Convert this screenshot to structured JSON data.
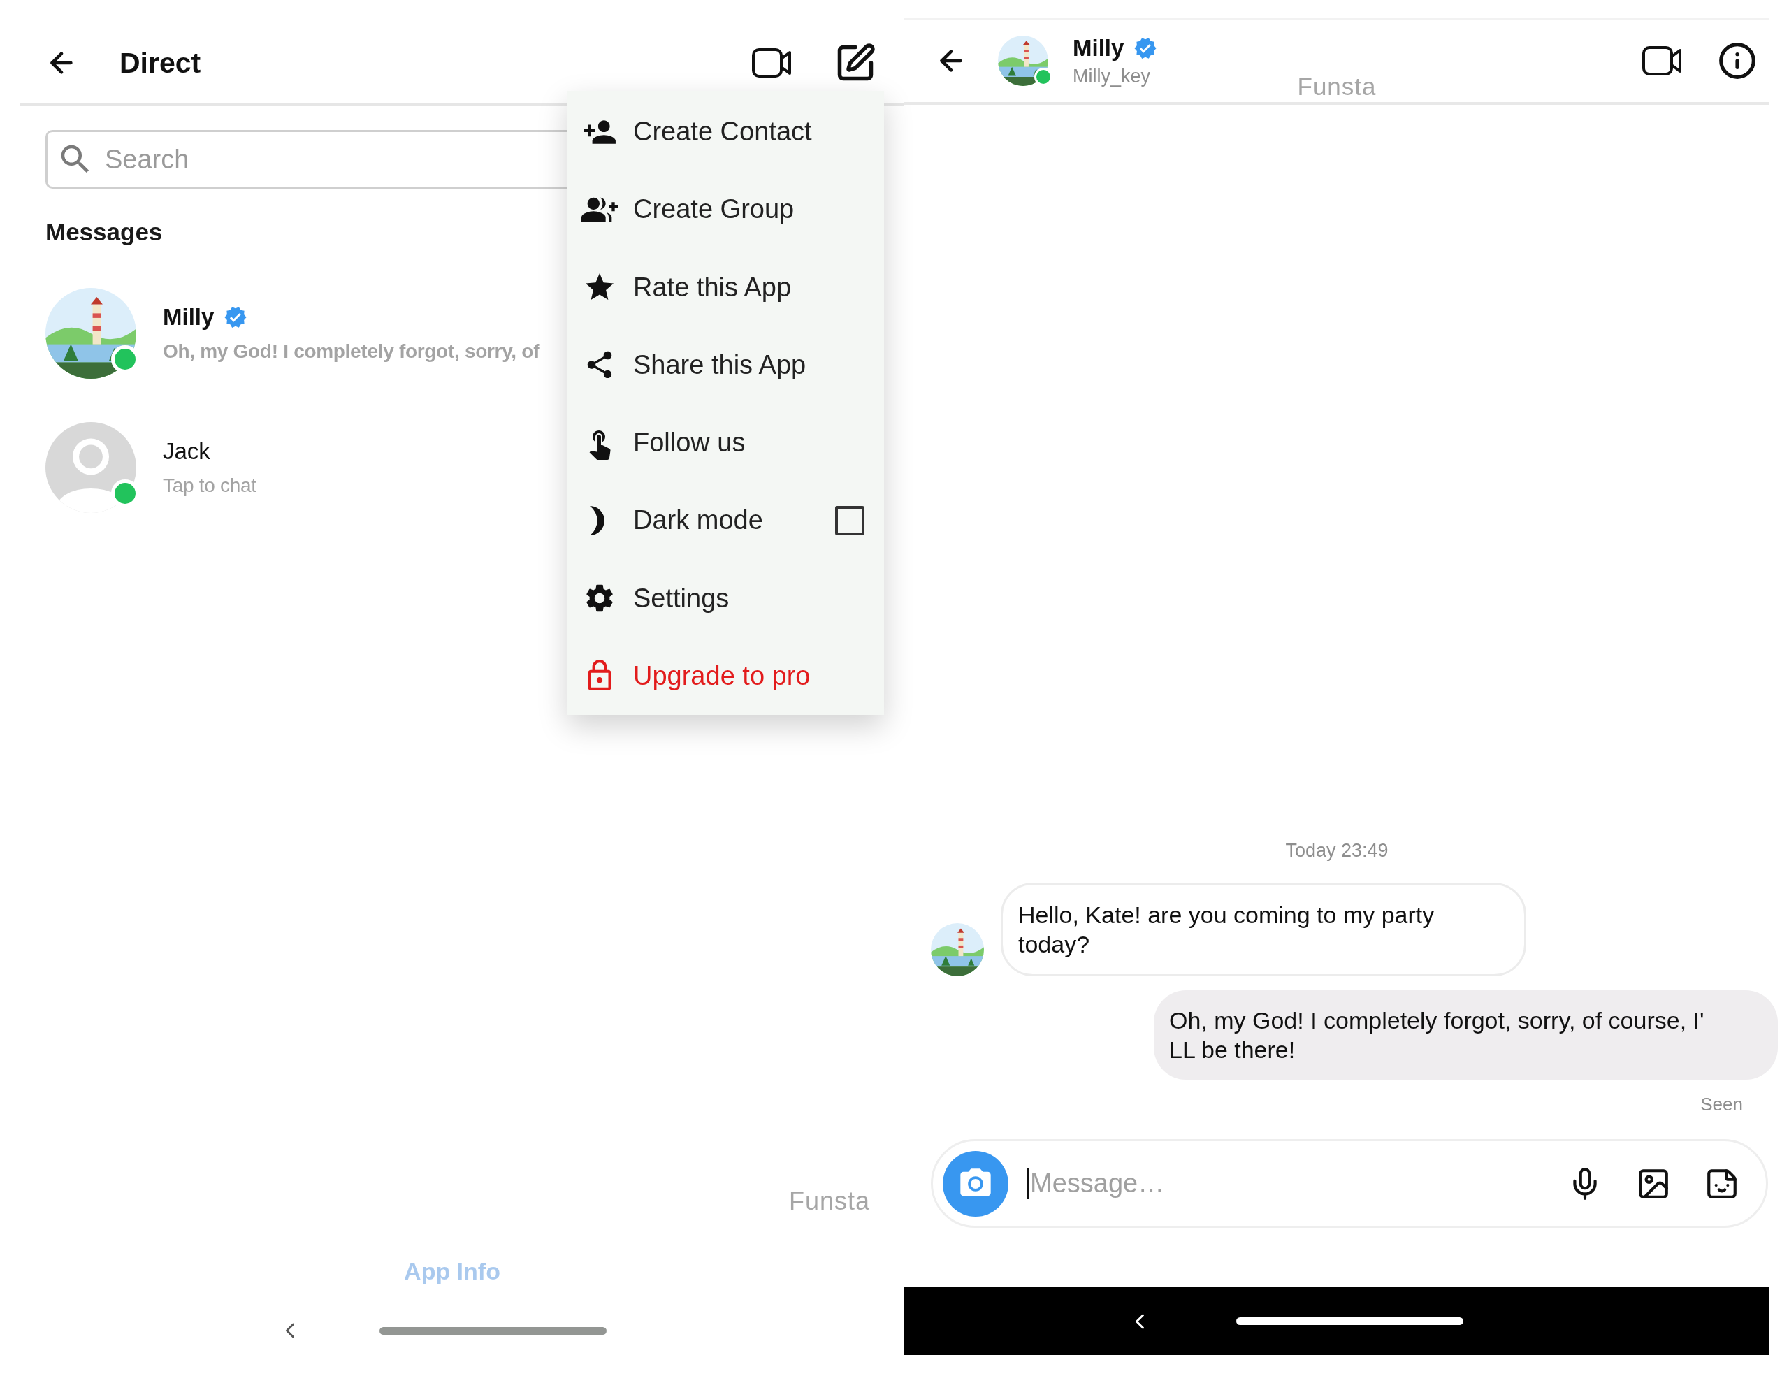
{
  "left_screen": {
    "header": {
      "title": "Direct"
    },
    "search": {
      "placeholder": "Search"
    },
    "section_title": "Messages",
    "conversations": [
      {
        "name": "Milly",
        "verified": true,
        "online": true,
        "photo": true,
        "unread": true,
        "preview": "Oh, my God! I completely forgot, sorry, of"
      },
      {
        "name": "Jack",
        "verified": false,
        "online": true,
        "photo": false,
        "unread": false,
        "preview": "Tap to chat"
      }
    ],
    "menu": [
      {
        "kind": "action",
        "label": "Create Contact"
      },
      {
        "kind": "action",
        "label": "Create Group"
      },
      {
        "kind": "action",
        "label": "Rate this App"
      },
      {
        "kind": "action",
        "label": "Share this App"
      },
      {
        "kind": "action",
        "label": "Follow us"
      },
      {
        "kind": "toggle",
        "label": "Dark mode",
        "checked": false
      },
      {
        "kind": "action",
        "label": "Settings"
      },
      {
        "kind": "upgrade",
        "label": "Upgrade to pro"
      }
    ],
    "brand_label": "Funsta",
    "footer_link": "App Info"
  },
  "right_screen": {
    "header": {
      "name": "Milly",
      "username": "Milly_key",
      "verified": true,
      "online": true
    },
    "brand_label": "Funsta",
    "timestamp": "Today 23:49",
    "messages": [
      {
        "outgoing": false,
        "text": "Hello, Kate! are you coming to my party today?"
      },
      {
        "outgoing": true,
        "text": "Oh, my God! I completely forgot, sorry, of course, I' LL be there!"
      }
    ],
    "status": "Seen",
    "composer": {
      "placeholder": "Message…"
    }
  }
}
